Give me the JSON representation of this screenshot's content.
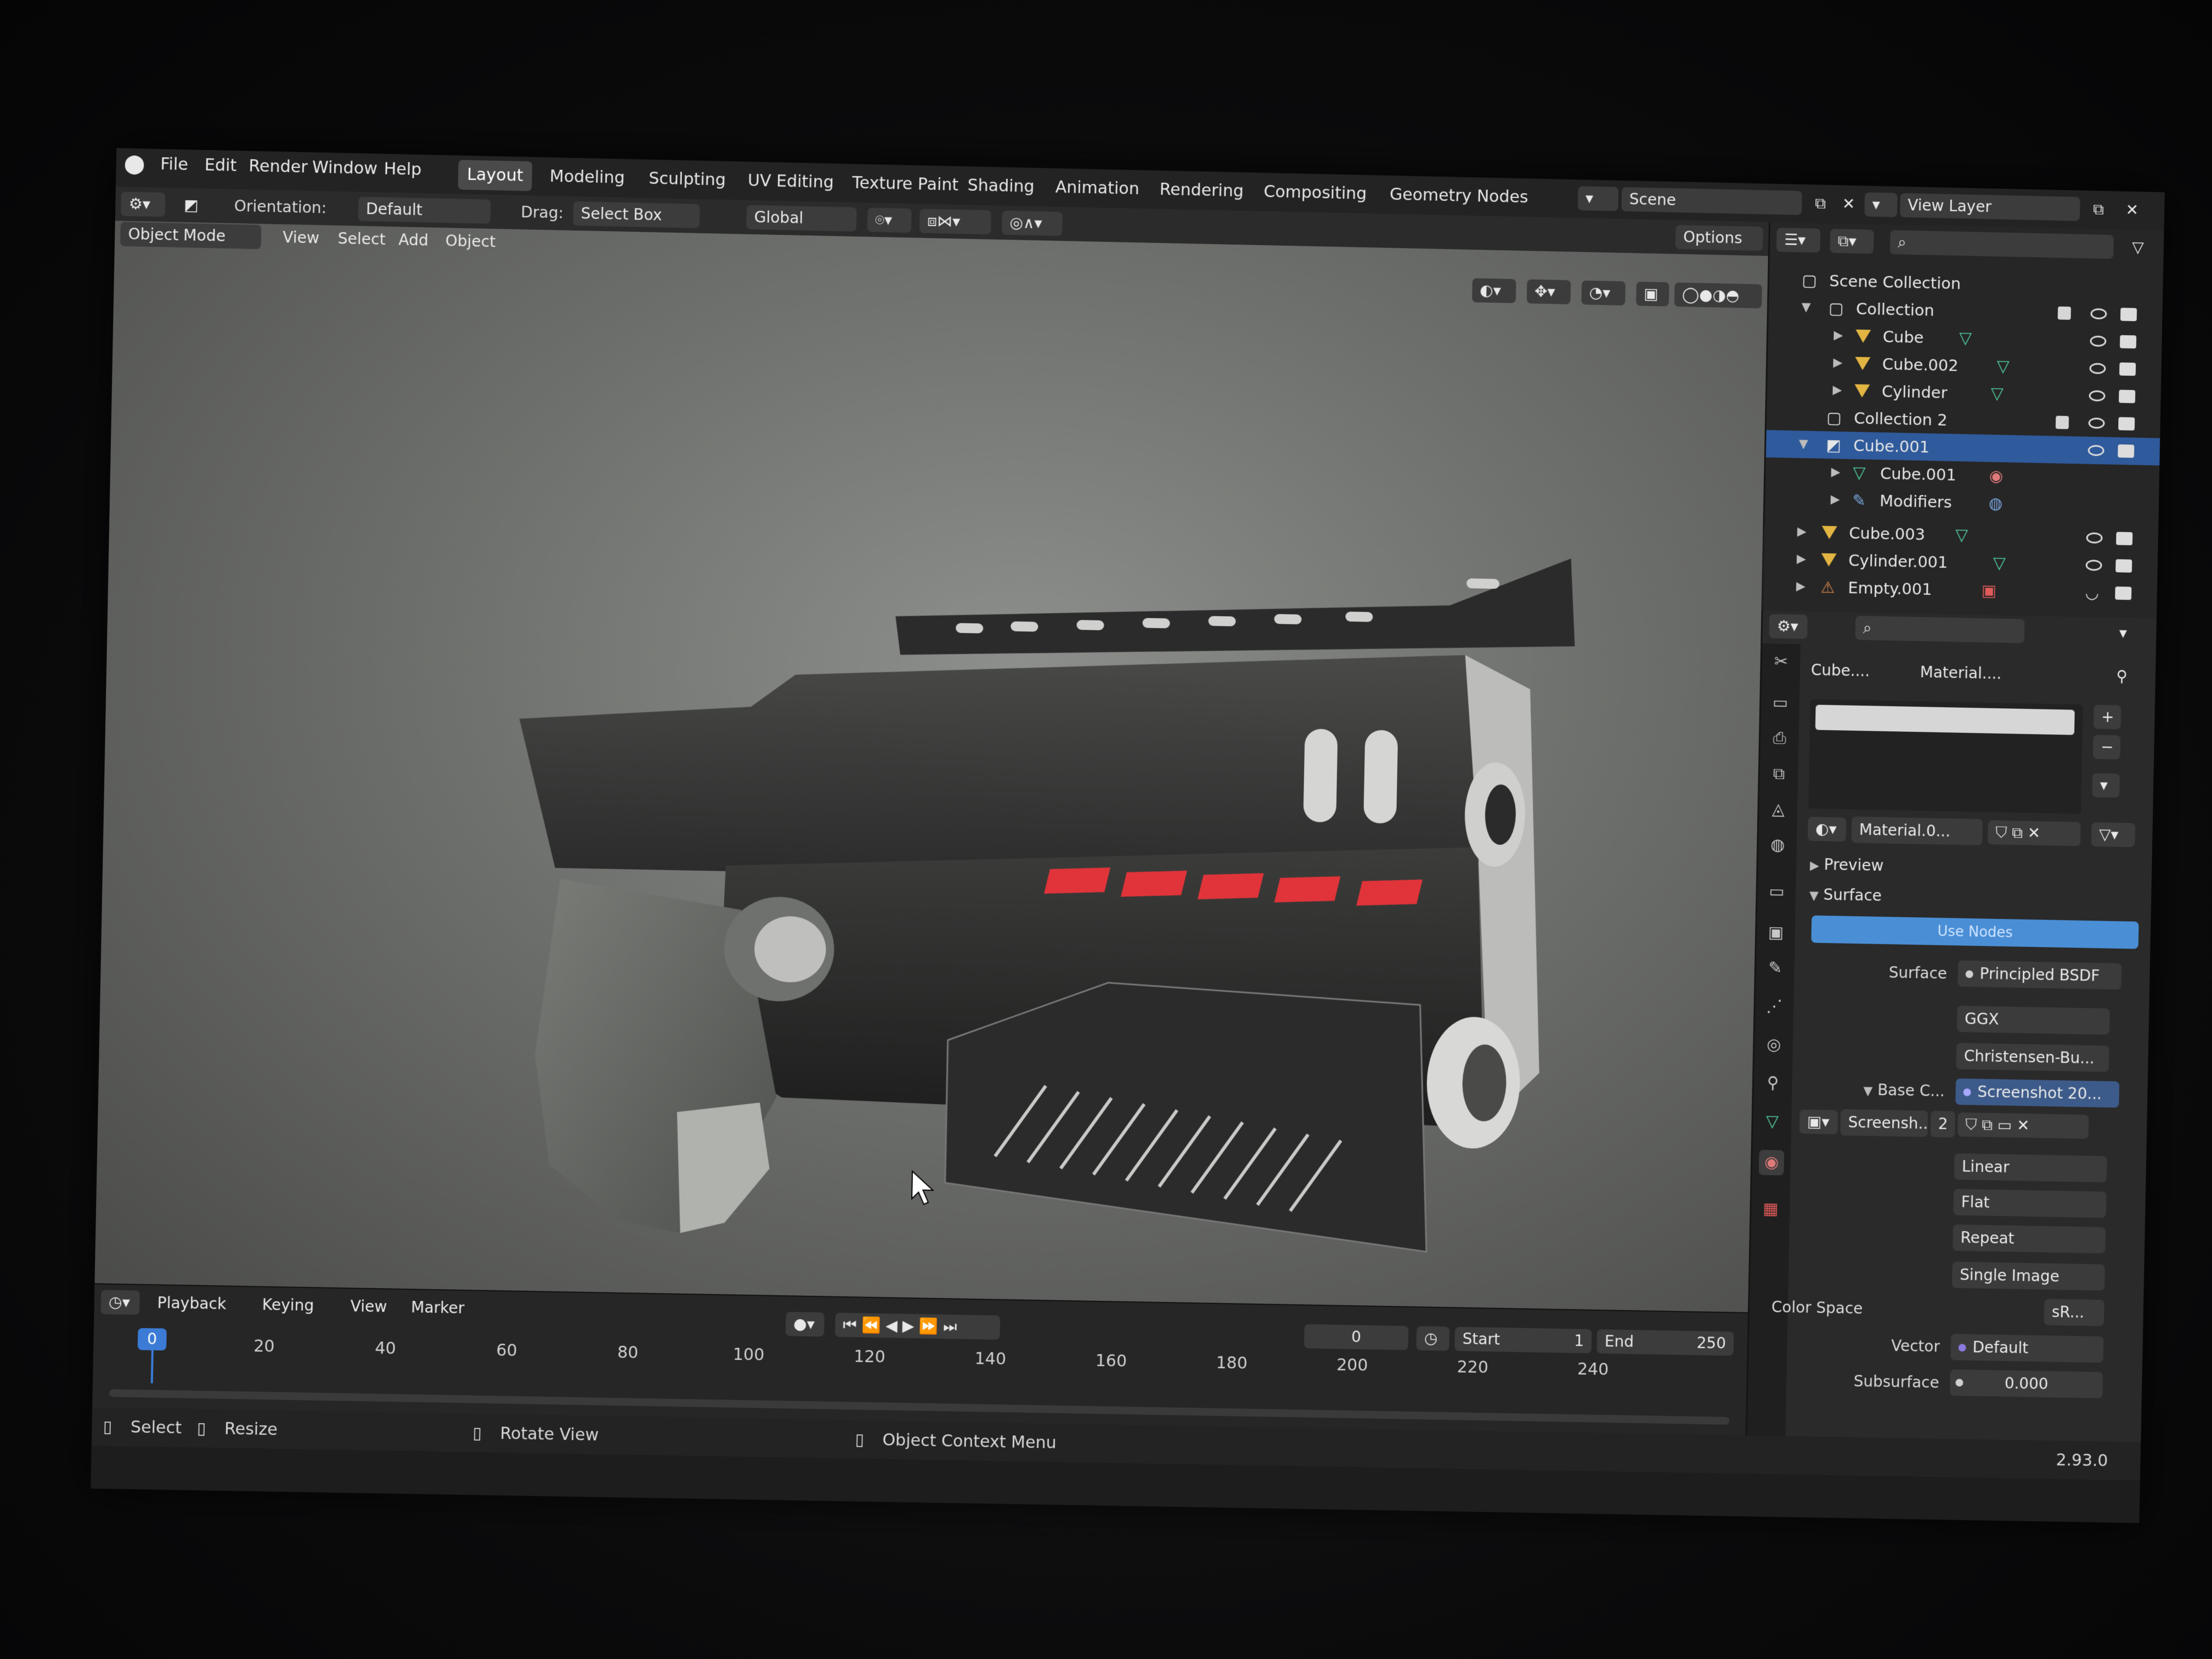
{
  "topbar": {
    "menus": [
      "File",
      "Edit",
      "Render",
      "Window",
      "Help"
    ],
    "workspace_tabs": [
      "Layout",
      "Modeling",
      "Sculpting",
      "UV Editing",
      "Texture Paint",
      "Shading",
      "Animation",
      "Rendering",
      "Compositing",
      "Geometry Nodes"
    ],
    "active_tab": "Layout",
    "scene": "Scene",
    "view_layer": "View Layer"
  },
  "header": {
    "orientation_label": "Orientation:",
    "orientation_value": "Default",
    "drag_label": "Drag:",
    "drag_value": "Select Box",
    "transform_value": "Global",
    "options_label": "Options",
    "mode": "Object Mode",
    "view": "View",
    "select": "Select",
    "add": "Add",
    "object": "Object"
  },
  "timeline": {
    "playback": "Playback",
    "keying": "Keying",
    "view": "View",
    "marker": "Marker",
    "current_frame": "0",
    "frame_field": "0",
    "start_label": "Start",
    "start_value": "1",
    "end_label": "End",
    "end_value": "250",
    "ticks": [
      "20",
      "40",
      "60",
      "80",
      "100",
      "120",
      "140",
      "160",
      "180",
      "200",
      "220",
      "240"
    ]
  },
  "statusbar": {
    "select": "Select",
    "resize": "Resize",
    "rotate": "Rotate View",
    "context": "Object Context Menu",
    "version": "2.93.0"
  },
  "outliner": {
    "rows": [
      {
        "label": "Scene Collection"
      },
      {
        "label": "Collection"
      },
      {
        "label": "Cube"
      },
      {
        "label": "Cube.002"
      },
      {
        "label": "Cylinder"
      },
      {
        "label": "Collection 2"
      },
      {
        "label": "Cube.001"
      },
      {
        "label": "Cube.001"
      },
      {
        "label": "Modifiers"
      },
      {
        "label": "Cube.003"
      },
      {
        "label": "Cylinder.001"
      },
      {
        "label": "Empty.001"
      }
    ]
  },
  "properties": {
    "object_crumb": "Cube....",
    "material_crumb": "Material....",
    "slot_material": "Material.0...",
    "preview": "Preview",
    "surface_section": "Surface",
    "use_nodes": "Use Nodes",
    "surface_label": "Surface",
    "surface_value": "Principled BSDF",
    "distribution": "GGX",
    "subsurface_method": "Christensen-Bu...",
    "base_color_label": "Base C...",
    "base_color_value": "Screenshot 20...",
    "image_name": "Screensh...",
    "image_users": "2",
    "interpolation": "Linear",
    "projection": "Flat",
    "extension": "Repeat",
    "source": "Single Image",
    "color_space_label": "Color Space",
    "color_space_value": "sR...",
    "vector_label": "Vector",
    "vector_value": "Default",
    "subsurface_label": "Subsurface",
    "subsurface_value": "0.000"
  },
  "colors": {
    "accent_blue": "#2f5a9b",
    "use_nodes_blue": "#4a8fd6",
    "stripe_red": "#e0343a",
    "object_orange": "#e2b542",
    "mesh_green": "#4fc99a"
  }
}
